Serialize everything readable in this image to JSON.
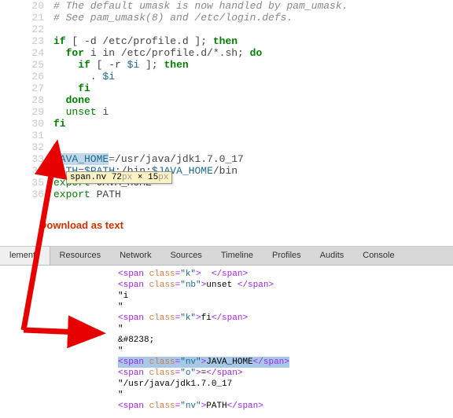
{
  "code": {
    "lines": [
      {
        "n": "20",
        "segments": [
          {
            "cls": "c1",
            "t": "# The default umask is now handled by pam_umask."
          }
        ]
      },
      {
        "n": "21",
        "segments": [
          {
            "cls": "c1",
            "t": "# See pam_umask(8) and /etc/login.defs."
          }
        ]
      },
      {
        "n": "22",
        "segments": []
      },
      {
        "n": "23",
        "segments": [
          {
            "cls": "k",
            "t": "if"
          },
          {
            "cls": "s1",
            "t": " [ -d /etc/profile.d ]; "
          },
          {
            "cls": "k",
            "t": "then"
          }
        ]
      },
      {
        "n": "24",
        "segments": [
          {
            "cls": "s1",
            "t": "  "
          },
          {
            "cls": "k",
            "t": "for"
          },
          {
            "cls": "s1",
            "t": " i in /etc/profile.d/*.sh; "
          },
          {
            "cls": "k",
            "t": "do"
          }
        ]
      },
      {
        "n": "25",
        "segments": [
          {
            "cls": "s1",
            "t": "    "
          },
          {
            "cls": "k",
            "t": "if"
          },
          {
            "cls": "s1",
            "t": " [ -r "
          },
          {
            "cls": "nv",
            "t": "$i"
          },
          {
            "cls": "s1",
            "t": " ]; "
          },
          {
            "cls": "k",
            "t": "then"
          }
        ]
      },
      {
        "n": "26",
        "segments": [
          {
            "cls": "s1",
            "t": "      . "
          },
          {
            "cls": "nv",
            "t": "$i"
          }
        ]
      },
      {
        "n": "27",
        "segments": [
          {
            "cls": "s1",
            "t": "    "
          },
          {
            "cls": "k",
            "t": "fi"
          }
        ]
      },
      {
        "n": "28",
        "segments": [
          {
            "cls": "s1",
            "t": "  "
          },
          {
            "cls": "k",
            "t": "done"
          }
        ]
      },
      {
        "n": "29",
        "segments": [
          {
            "cls": "s1",
            "t": "  "
          },
          {
            "cls": "nb",
            "t": "unset"
          },
          {
            "cls": "s1",
            "t": " i"
          }
        ]
      },
      {
        "n": "30",
        "segments": [
          {
            "cls": "k",
            "t": "fi"
          }
        ]
      },
      {
        "n": "31",
        "segments": []
      },
      {
        "n": "32",
        "segments": []
      },
      {
        "n": "33",
        "segments": [
          {
            "cls": "nv highlight",
            "t": "JAVA_HOME"
          },
          {
            "cls": "o",
            "t": "="
          },
          {
            "cls": "s1",
            "t": "/usr/java/jdk1.7.0_17"
          }
        ]
      },
      {
        "n": "34",
        "segments": [
          {
            "cls": "nv",
            "t": "PATH"
          },
          {
            "cls": "o",
            "t": "="
          },
          {
            "cls": "nv",
            "t": "$PATH"
          },
          {
            "cls": "s1",
            "t": ":/bin:"
          },
          {
            "cls": "nv",
            "t": "$JAVA_HOME"
          },
          {
            "cls": "s1",
            "t": "/bin"
          }
        ]
      },
      {
        "n": "35",
        "segments": [
          {
            "cls": "nb",
            "t": "export"
          },
          {
            "cls": "s1",
            "t": " JAVA_HOME"
          }
        ]
      },
      {
        "n": "36",
        "segments": [
          {
            "cls": "nb",
            "t": "export"
          },
          {
            "cls": "s1",
            "t": " PATH"
          }
        ]
      }
    ]
  },
  "tooltip": {
    "selector": "span.nv",
    "w": "72",
    "wx": "px",
    "sep": " × ",
    "h": "15",
    "hx": "px"
  },
  "download_label": "Download as text",
  "devtools": {
    "tabs": [
      "lements",
      "Resources",
      "Network",
      "Sources",
      "Timeline",
      "Profiles",
      "Audits",
      "Console"
    ],
    "active_index": 0,
    "dom_lines": [
      {
        "segs": [
          {
            "cls": "tag",
            "t": "<span "
          },
          {
            "cls": "attr",
            "t": "class"
          },
          {
            "cls": "tag",
            "t": "="
          },
          {
            "cls": "attrv",
            "t": "\"k\""
          },
          {
            "cls": "tag",
            "t": ">"
          },
          {
            "cls": "text",
            "t": "  "
          },
          {
            "cls": "tag",
            "t": "</span>"
          }
        ]
      },
      {
        "segs": [
          {
            "cls": "tag",
            "t": "<span "
          },
          {
            "cls": "attr",
            "t": "class"
          },
          {
            "cls": "tag",
            "t": "="
          },
          {
            "cls": "attrv",
            "t": "\"nb\""
          },
          {
            "cls": "tag",
            "t": ">"
          },
          {
            "cls": "text",
            "t": "unset "
          },
          {
            "cls": "tag",
            "t": "</span>"
          }
        ]
      },
      {
        "segs": [
          {
            "cls": "text",
            "t": "\"i"
          }
        ]
      },
      {
        "segs": [
          {
            "cls": "text",
            "t": "\""
          }
        ]
      },
      {
        "segs": [
          {
            "cls": "tag",
            "t": "<span "
          },
          {
            "cls": "attr",
            "t": "class"
          },
          {
            "cls": "tag",
            "t": "="
          },
          {
            "cls": "attrv",
            "t": "\"k\""
          },
          {
            "cls": "tag",
            "t": ">"
          },
          {
            "cls": "text",
            "t": "fi"
          },
          {
            "cls": "tag",
            "t": "</span>"
          }
        ]
      },
      {
        "segs": [
          {
            "cls": "text",
            "t": "\""
          }
        ]
      },
      {
        "segs": [
          {
            "cls": "text",
            "t": "&#8238;"
          }
        ]
      },
      {
        "segs": [
          {
            "cls": "text",
            "t": "\""
          }
        ]
      },
      {
        "segs": []
      },
      {
        "sel": true,
        "segs": [
          {
            "cls": "tag",
            "t": "<span "
          },
          {
            "cls": "attr",
            "t": "class"
          },
          {
            "cls": "tag",
            "t": "="
          },
          {
            "cls": "attrv",
            "t": "\"nv\""
          },
          {
            "cls": "tag",
            "t": ">"
          },
          {
            "cls": "text",
            "t": "JAVA_HOME"
          },
          {
            "cls": "tag",
            "t": "</span>"
          }
        ]
      },
      {
        "segs": [
          {
            "cls": "tag",
            "t": "<span "
          },
          {
            "cls": "attr",
            "t": "class"
          },
          {
            "cls": "tag",
            "t": "="
          },
          {
            "cls": "attrv",
            "t": "\"o\""
          },
          {
            "cls": "tag",
            "t": ">"
          },
          {
            "cls": "text",
            "t": "="
          },
          {
            "cls": "tag",
            "t": "</span>"
          }
        ]
      },
      {
        "segs": [
          {
            "cls": "text",
            "t": "\"/usr/java/jdk1.7.0_17"
          }
        ]
      },
      {
        "segs": [
          {
            "cls": "text",
            "t": "\""
          }
        ]
      },
      {
        "segs": [
          {
            "cls": "tag",
            "t": "<span "
          },
          {
            "cls": "attr",
            "t": "class"
          },
          {
            "cls": "tag",
            "t": "="
          },
          {
            "cls": "attrv",
            "t": "\"nv\""
          },
          {
            "cls": "tag",
            "t": ">"
          },
          {
            "cls": "text",
            "t": "PATH"
          },
          {
            "cls": "tag",
            "t": "</span>"
          }
        ]
      }
    ]
  }
}
